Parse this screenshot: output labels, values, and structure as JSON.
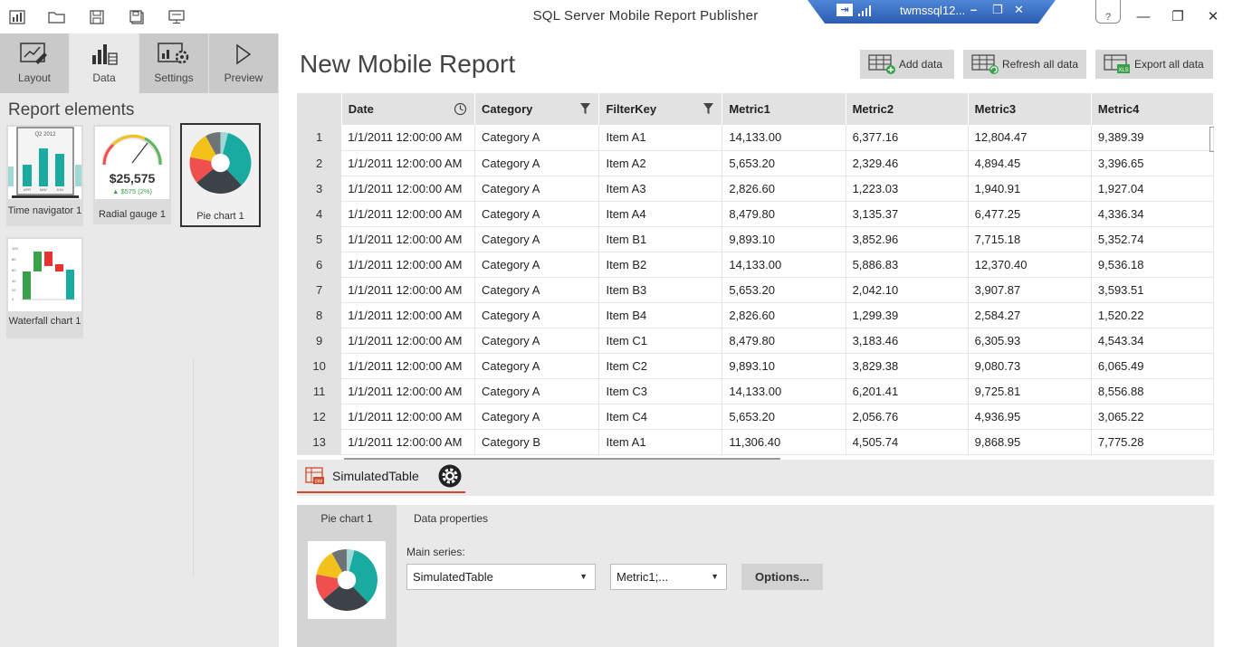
{
  "window": {
    "title": "SQL Server Mobile Report Publisher",
    "remote_session": "twmssql12...",
    "help_glyph": "?"
  },
  "nav": {
    "tabs": [
      {
        "label": "Layout",
        "icon": "layout-icon"
      },
      {
        "label": "Data",
        "icon": "data-icon"
      },
      {
        "label": "Settings",
        "icon": "settings-icon"
      },
      {
        "label": "Preview",
        "icon": "preview-icon"
      }
    ],
    "active": "Data"
  },
  "report_elements": {
    "title": "Report elements",
    "items": [
      {
        "label": "Time navigator 1",
        "thumb_text": "Q2 2012",
        "months": [
          "APR",
          "MAY",
          "JUN"
        ]
      },
      {
        "label": "Radial gauge 1",
        "value": "$25,575",
        "delta": "▲ $575 (2%)"
      },
      {
        "label": "Pie chart 1",
        "selected": true
      },
      {
        "label": "Waterfall chart 1",
        "axis": [
          "100",
          "80",
          "60",
          "40",
          "20",
          "0"
        ]
      }
    ]
  },
  "report": {
    "title": "New Mobile Report",
    "toolbar": {
      "add_data": "Add data",
      "refresh_all": "Refresh all data",
      "export_all": "Export all data"
    }
  },
  "grid": {
    "columns": [
      "Date",
      "Category",
      "FilterKey",
      "Metric1",
      "Metric2",
      "Metric3",
      "Metric4"
    ],
    "rows": [
      [
        "1",
        "1/1/2011 12:00:00 AM",
        "Category A",
        "Item A1",
        "14,133.00",
        "6,377.16",
        "12,804.47",
        "9,389.39"
      ],
      [
        "2",
        "1/1/2011 12:00:00 AM",
        "Category A",
        "Item A2",
        "5,653.20",
        "2,329.46",
        "4,894.45",
        "3,396.65"
      ],
      [
        "3",
        "1/1/2011 12:00:00 AM",
        "Category A",
        "Item A3",
        "2,826.60",
        "1,223.03",
        "1,940.91",
        "1,927.04"
      ],
      [
        "4",
        "1/1/2011 12:00:00 AM",
        "Category A",
        "Item A4",
        "8,479.80",
        "3,135.37",
        "6,477.25",
        "4,336.34"
      ],
      [
        "5",
        "1/1/2011 12:00:00 AM",
        "Category A",
        "Item B1",
        "9,893.10",
        "3,852.96",
        "7,715.18",
        "5,352.74"
      ],
      [
        "6",
        "1/1/2011 12:00:00 AM",
        "Category A",
        "Item B2",
        "14,133.00",
        "5,886.83",
        "12,370.40",
        "9,536.18"
      ],
      [
        "7",
        "1/1/2011 12:00:00 AM",
        "Category A",
        "Item B3",
        "5,653.20",
        "2,042.10",
        "3,907.87",
        "3,593.51"
      ],
      [
        "8",
        "1/1/2011 12:00:00 AM",
        "Category A",
        "Item B4",
        "2,826.60",
        "1,299.39",
        "2,584.27",
        "1,520.22"
      ],
      [
        "9",
        "1/1/2011 12:00:00 AM",
        "Category A",
        "Item C1",
        "8,479.80",
        "3,183.46",
        "6,305.93",
        "4,543.34"
      ],
      [
        "10",
        "1/1/2011 12:00:00 AM",
        "Category A",
        "Item C2",
        "9,893.10",
        "3,829.38",
        "9,080.73",
        "6,065.49"
      ],
      [
        "11",
        "1/1/2011 12:00:00 AM",
        "Category A",
        "Item C3",
        "14,133.00",
        "6,201.41",
        "9,725.81",
        "8,556.88"
      ],
      [
        "12",
        "1/1/2011 12:00:00 AM",
        "Category A",
        "Item C4",
        "5,653.20",
        "2,056.76",
        "4,936.95",
        "3,065.22"
      ],
      [
        "13",
        "1/1/2011 12:00:00 AM",
        "Category B",
        "Item A1",
        "11,306.40",
        "4,505.74",
        "9,868.95",
        "7,775.28"
      ]
    ]
  },
  "dataset_tab": {
    "name": "SimulatedTable"
  },
  "properties": {
    "element_tab": "Pie chart 1",
    "data_tab": "Data properties",
    "main_series_label": "Main series:",
    "table_select": "SimulatedTable",
    "metric_select": "Metric1;...",
    "options_button": "Options..."
  },
  "colors": {
    "teal": "#1aaba0",
    "dark": "#3c4248",
    "red": "#f0504d",
    "yellow": "#f2c21b",
    "gray": "#6e7377",
    "accent_orange": "#d24726"
  }
}
